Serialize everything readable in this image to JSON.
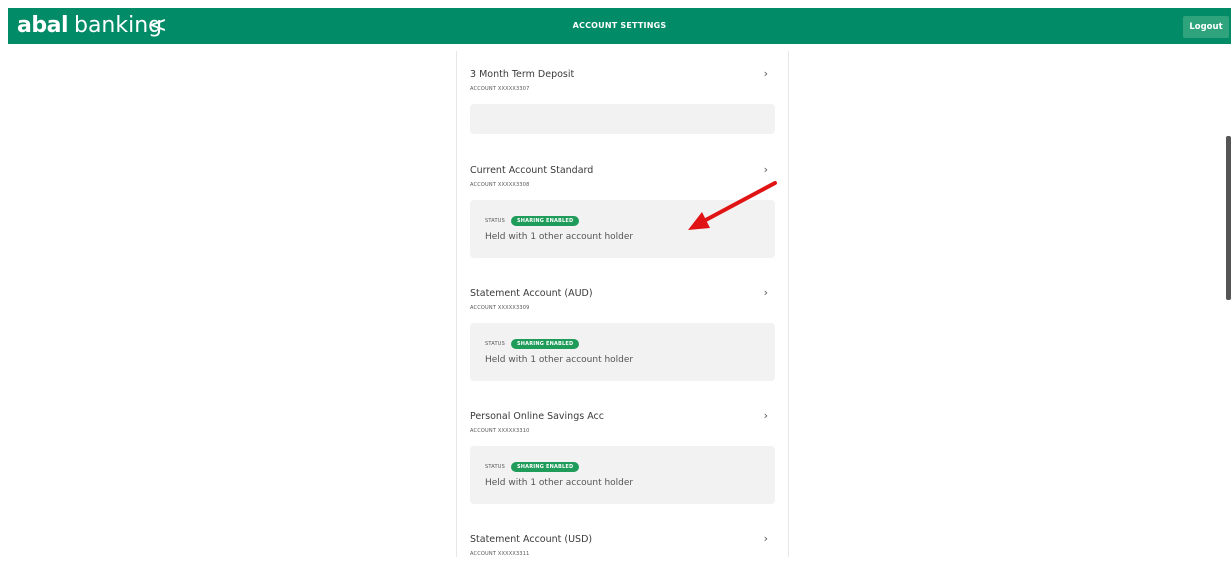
{
  "header": {
    "logo_brand": "abal",
    "logo_word": "banking",
    "back_label": "<",
    "title": "ACCOUNT SETTINGS",
    "logout_label": "Logout"
  },
  "accounts": [
    {
      "name": "3 Month Term Deposit",
      "number": "ACCOUNT XXXXX3307",
      "chevron": "›"
    },
    {
      "name": "Current Account Standard",
      "number": "ACCOUNT XXXXX3308",
      "chevron": "›",
      "status_label": "STATUS",
      "status": "SHARING ENABLED",
      "held": "Held with 1 other account holder"
    },
    {
      "name": "Statement Account (AUD)",
      "number": "ACCOUNT XXXXX3309",
      "chevron": "›",
      "status_label": "STATUS",
      "status": "SHARING ENABLED",
      "held": "Held with 1 other account holder"
    },
    {
      "name": "Personal Online Savings Acc",
      "number": "ACCOUNT XXXXX3310",
      "chevron": "›",
      "status_label": "STATUS",
      "status": "SHARING ENABLED",
      "held": "Held with 1 other account holder"
    },
    {
      "name": "Statement Account (USD)",
      "number": "ACCOUNT XXXXX3311",
      "chevron": "›"
    }
  ],
  "colors": {
    "header_bg": "#018b67",
    "logout_bg": "#2fa47c",
    "badge_bg": "#1f9b5a",
    "annotation_arrow": "#e01414"
  },
  "icons": {
    "back": "chevron-left-icon",
    "row": "chevron-right-icon",
    "annotation": "red-arrow-icon"
  }
}
